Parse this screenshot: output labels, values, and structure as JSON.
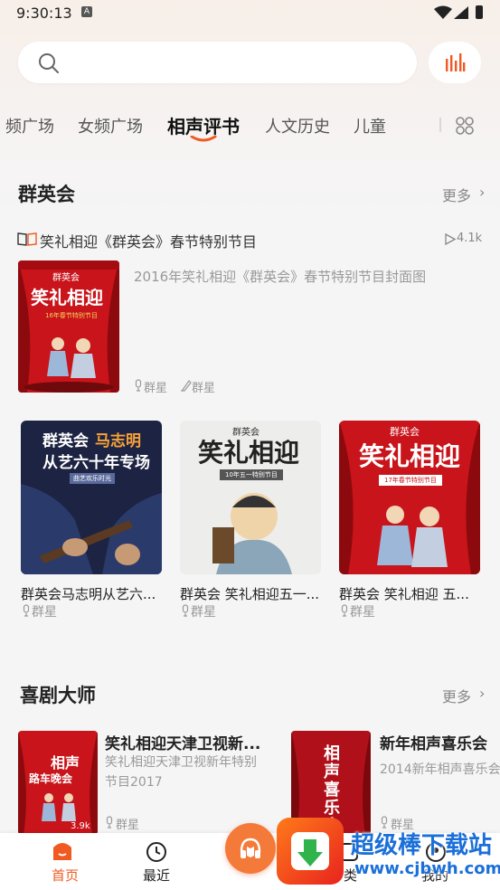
{
  "status_bar": {
    "time": "9:30:13",
    "sim": "A"
  },
  "search": {
    "placeholder": ""
  },
  "tabs": [
    {
      "label": "频广场"
    },
    {
      "label": "女频广场"
    },
    {
      "label": "相声评书",
      "active": true
    },
    {
      "label": "人文历史"
    },
    {
      "label": "儿童"
    }
  ],
  "section1": {
    "title": "群英会",
    "more": "更多",
    "feature": {
      "title": "笑礼相迎《群英会》春节特别节目",
      "play_count": "4.1k",
      "description": "2016年笑礼相迎《群英会》春节特别节目封面图",
      "anchor": "群星",
      "author": "群星",
      "cover_text": {
        "top": "群英会",
        "main": "笑礼相迎",
        "sub": "16年春节特别节目"
      }
    },
    "cards": [
      {
        "title": "群英会马志明从艺六...",
        "anchor": "群星",
        "cover_text": {
          "line1": "群英会",
          "line1b": "马志明",
          "line2": "从艺六十年专场",
          "badge": "曲艺欢乐时光"
        }
      },
      {
        "title": "群英会 笑礼相迎五一...",
        "anchor": "群星",
        "cover_text": {
          "top": "群英会",
          "main": "笑礼相迎",
          "sub": "10年五一特别节目"
        }
      },
      {
        "title": "群英会 笑礼相迎 五...",
        "anchor": "群星",
        "cover_text": {
          "top": "群英会",
          "main": "笑礼相迎",
          "sub": "17年春节特别节目"
        }
      }
    ]
  },
  "section2": {
    "title": "喜剧大师",
    "more": "更多",
    "items": [
      {
        "title": "笑礼相迎天津卫视新...",
        "desc": "笑礼相迎天津卫视新年特别节目2017",
        "anchor": "群星",
        "cover_text": {
          "main": "相声",
          "sub": "路车晚会",
          "count": "3.9k"
        }
      },
      {
        "title": "新年相声喜乐会",
        "desc": "2014新年相声喜乐会",
        "anchor": "群星",
        "cover_text": {
          "main": "相声喜乐会"
        }
      }
    ]
  },
  "bottom_nav": [
    {
      "label": "首页",
      "active": true
    },
    {
      "label": "最近"
    },
    {
      "label": ""
    },
    {
      "label": "类"
    },
    {
      "label": "我的"
    }
  ],
  "watermark": {
    "brand": "超级棒下载站",
    "url": "www.cjbwh.com"
  },
  "colors": {
    "accent": "#f05a22",
    "red_cover": "#c8141a",
    "dark_cover": "#1d2342"
  }
}
